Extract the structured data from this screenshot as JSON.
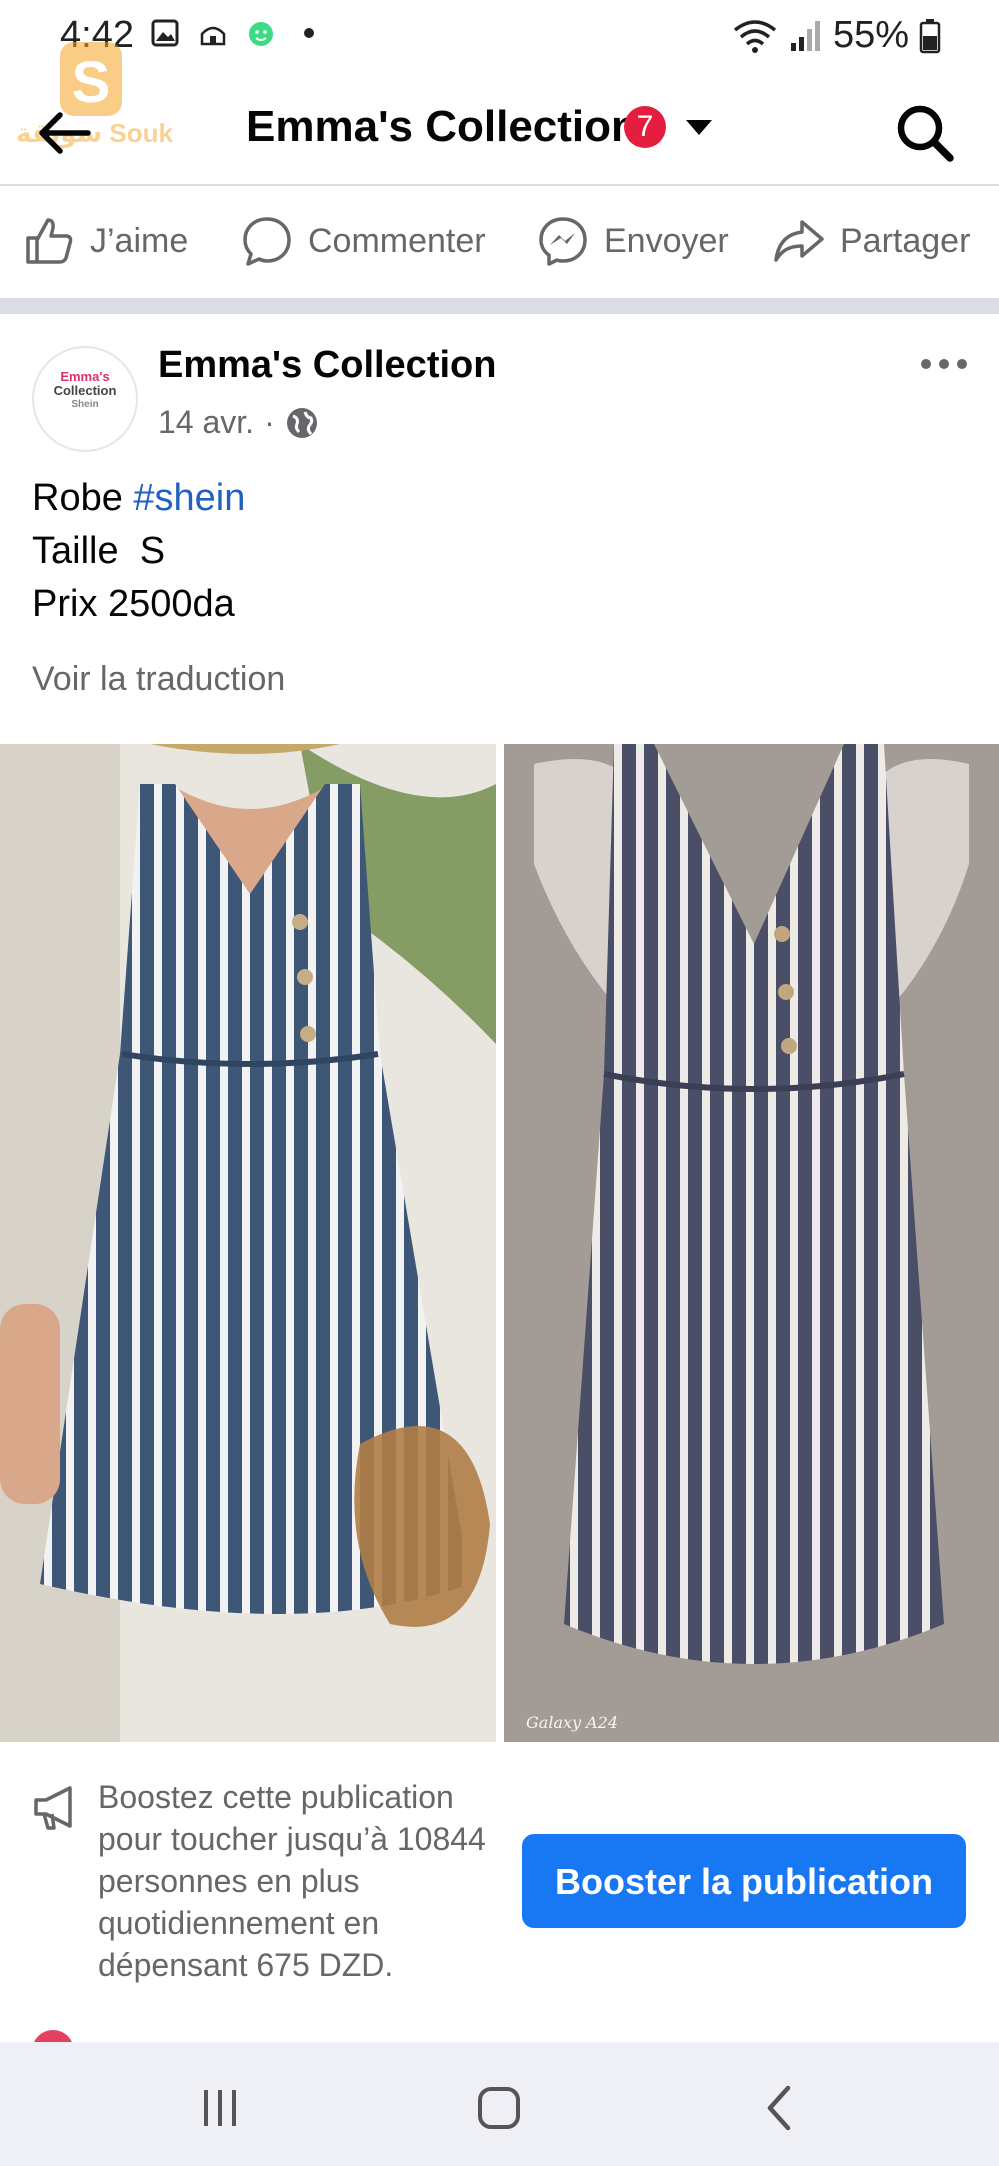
{
  "status_bar": {
    "time": "4:42",
    "battery": "55%",
    "icons_left": [
      "image-icon",
      "mosque-icon",
      "android-icon",
      "dot-icon"
    ],
    "icons_right": [
      "wifi-icon",
      "signal-icon",
      "battery-icon"
    ]
  },
  "watermark": {
    "text": "سويقة Souk"
  },
  "header": {
    "title": "Emma's Collection",
    "notification_count": "7"
  },
  "actions": [
    {
      "label": "J’aime",
      "icon": "like-icon"
    },
    {
      "label": "Commenter",
      "icon": "comment-icon"
    },
    {
      "label": "Envoyer",
      "icon": "messenger-icon"
    },
    {
      "label": "Partager",
      "icon": "share-icon"
    }
  ],
  "post": {
    "author": "Emma's Collection",
    "avatar_text": {
      "line1": "Emma's",
      "line2": "Collection",
      "line3": "Shein"
    },
    "date": "14 avr.",
    "separator": "·",
    "text_line1_prefix": "Robe ",
    "hashtag": "#shein",
    "text_line2": "Taille  S",
    "text_line3": "Prix 2500da",
    "translate_label": "Voir la traduction",
    "photo_right_caption": "Galaxy A24"
  },
  "boost": {
    "text": "Boostez cette publication pour toucher jusqu’à 10844 personnes en plus quotidiennement en dépensant 675 DZD.",
    "button_label": "Booster la publication"
  },
  "colors": {
    "accent": "#1877f2",
    "badge": "#e41e3f",
    "secondary_text": "#65676b",
    "hashtag": "#1f62c1"
  }
}
